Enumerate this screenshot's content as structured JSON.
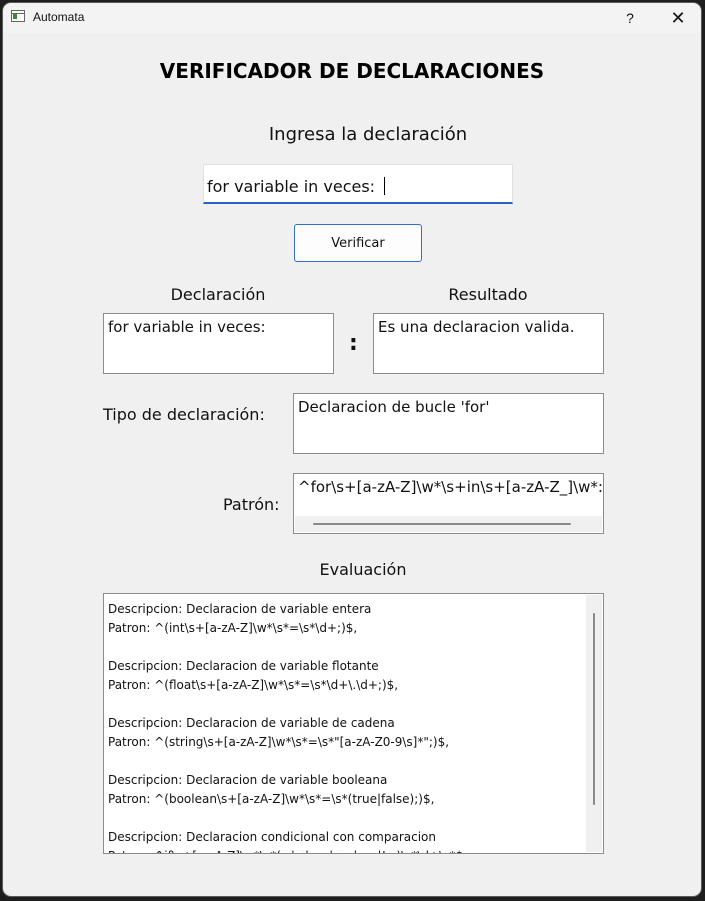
{
  "window": {
    "title": "Automata",
    "help": "?",
    "close": "✕"
  },
  "heading": "VERIFICADOR DE DECLARACIONES",
  "prompt_label": "Ingresa la declaración",
  "input": {
    "value": "for variable in veces: "
  },
  "verify_button": "Verificar",
  "declaration": {
    "label": "Declaración",
    "value": "for variable in veces:"
  },
  "separator": ":",
  "result": {
    "label": "Resultado",
    "value": "Es una declaracion valida."
  },
  "type": {
    "label": "Tipo de declaración:",
    "value": "Declaracion de bucle 'for'"
  },
  "pattern": {
    "label": "Patrón:",
    "value": "^for\\s+[a-zA-Z]\\w*\\s+in\\s+[a-zA-Z_]\\w*:\\s*"
  },
  "evaluation": {
    "label": "Evaluación",
    "text": "Descripcion: Declaracion de variable entera\nPatron: ^(int\\s+[a-zA-Z]\\w*\\s*=\\s*\\d+;)$,\n\nDescripcion: Declaracion de variable flotante\nPatron: ^(float\\s+[a-zA-Z]\\w*\\s*=\\s*\\d+\\.\\d+;)$,\n\nDescripcion: Declaracion de variable de cadena\nPatron: ^(string\\s+[a-zA-Z]\\w*\\s*=\\s*\"[a-zA-Z0-9\\s]*\";)$,\n\nDescripcion: Declaracion de variable booleana\nPatron: ^(boolean\\s+[a-zA-Z]\\w*\\s*=\\s*(true|false);)$,\n\nDescripcion: Declaracion condicional con comparacion\nPatron: ^if\\s+[a-zA-Z]\\w*\\s*(>|<|>=|<=|==|!=)\\s*\\d+\\s*$"
  }
}
